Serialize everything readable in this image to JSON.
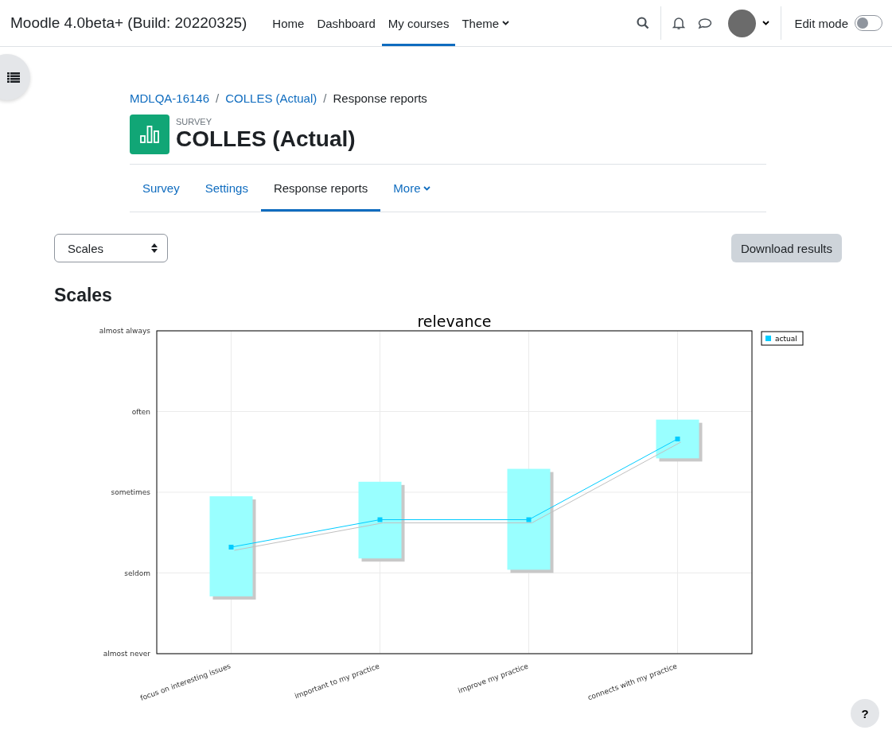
{
  "header": {
    "site_name": "Moodle 4.0beta+ (Build: 20220325)",
    "nav": [
      {
        "label": "Home",
        "selected": false,
        "kind": "link"
      },
      {
        "label": "Dashboard",
        "selected": false,
        "kind": "link"
      },
      {
        "label": "My courses",
        "selected": true,
        "kind": "link"
      },
      {
        "label": "Theme",
        "selected": false,
        "kind": "dropdown"
      }
    ],
    "edit_mode": {
      "label": "Edit mode",
      "on": false
    }
  },
  "breadcrumb": [
    {
      "label": "MDLQA-16146",
      "kind": "link"
    },
    {
      "separator": "/",
      "label": "COLLES (Actual)",
      "kind": "link"
    },
    {
      "separator": "/",
      "label": "Response reports",
      "kind": "current"
    }
  ],
  "activity": {
    "type_label": "SURVEY",
    "title": "COLLES (Actual)"
  },
  "tabs": [
    {
      "label": "Survey",
      "selected": false,
      "kind": "link"
    },
    {
      "label": "Settings",
      "selected": false,
      "kind": "link"
    },
    {
      "label": "Response reports",
      "selected": true,
      "kind": "link"
    },
    {
      "label": "More",
      "selected": false,
      "kind": "dropdown"
    }
  ],
  "report_select": {
    "value": "Scales"
  },
  "download_button": "Download results",
  "heading": "Scales",
  "chart": {
    "title": "relevance",
    "x_labels": [
      "focus on interesting issues",
      "important to my practice",
      "improve my practice",
      "connects with my practice"
    ],
    "y_labels": [
      "almost always",
      "often",
      "sometimes",
      "seldom",
      "almost never"
    ],
    "legend": [
      "actual"
    ]
  },
  "help_button": "?"
}
